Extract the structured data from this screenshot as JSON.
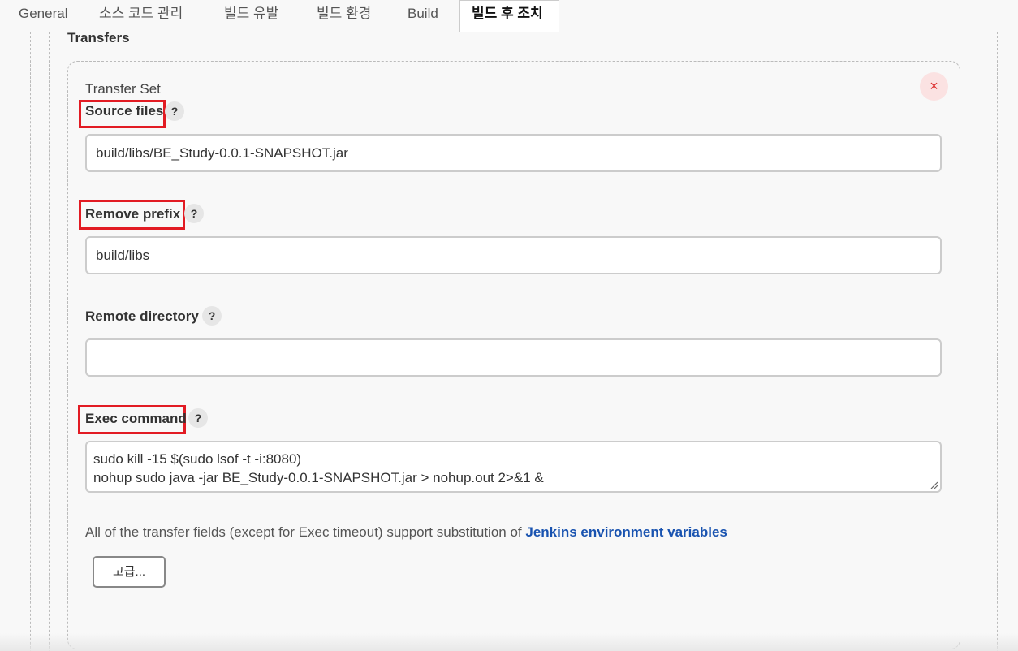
{
  "tabs": [
    {
      "label": "General",
      "active": false
    },
    {
      "label": "소스 코드 관리",
      "active": false
    },
    {
      "label": "빌드 유발",
      "active": false
    },
    {
      "label": "빌드 환경",
      "active": false
    },
    {
      "label": "Build",
      "active": false
    },
    {
      "label": "빌드 후 조치",
      "active": true
    }
  ],
  "section": {
    "title": "Transfers",
    "transfer_set_label": "Transfer Set",
    "close_glyph": "×"
  },
  "fields": {
    "source_files": {
      "label": "Source files",
      "value": "build/libs/BE_Study-0.0.1-SNAPSHOT.jar",
      "help": "?"
    },
    "remove_prefix": {
      "label": "Remove prefix",
      "value": "build/libs",
      "help": "?"
    },
    "remote_directory": {
      "label": "Remote directory",
      "value": "",
      "help": "?"
    },
    "exec_command": {
      "label": "Exec command",
      "value": "sudo kill -15 $(sudo lsof -t -i:8080)\nnohup sudo java -jar BE_Study-0.0.1-SNAPSHOT.jar > nohup.out 2>&1 &",
      "help": "?"
    }
  },
  "note": {
    "text": "All of the transfer fields (except for Exec timeout) support substitution of ",
    "link": "Jenkins environment variables"
  },
  "advanced_button": "고급...",
  "colors": {
    "highlight": "#e21b23",
    "link": "#1953b0",
    "close_bg": "#fbe2e2",
    "close_fg": "#dd3333"
  }
}
